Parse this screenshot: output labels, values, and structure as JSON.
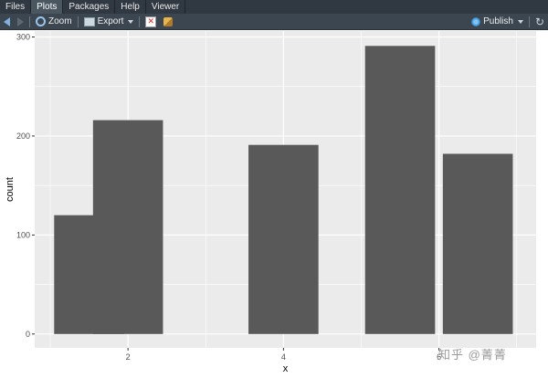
{
  "tabs": [
    {
      "label": "Files",
      "active": false
    },
    {
      "label": "Plots",
      "active": true
    },
    {
      "label": "Packages",
      "active": false
    },
    {
      "label": "Help",
      "active": false
    },
    {
      "label": "Viewer",
      "active": false
    }
  ],
  "toolbar": {
    "zoom_label": "Zoom",
    "export_label": "Export",
    "publish_label": "Publish"
  },
  "watermark": "知乎 @菁菁",
  "chart_data": {
    "type": "bar",
    "x": [
      1.5,
      2,
      4,
      5.5,
      6.5
    ],
    "values": [
      120,
      216,
      191,
      291,
      182
    ],
    "xlabel": "x",
    "ylabel": "count",
    "xticks": [
      2,
      4,
      6
    ],
    "yticks": [
      0,
      100,
      200,
      300
    ],
    "xlim": [
      0.8,
      7.25
    ],
    "ylim": [
      -14,
      306
    ],
    "bar_width": 0.9,
    "grid": true,
    "colors": {
      "bar": "#595959",
      "panel": "#ebebeb",
      "grid": "#ffffff"
    }
  }
}
